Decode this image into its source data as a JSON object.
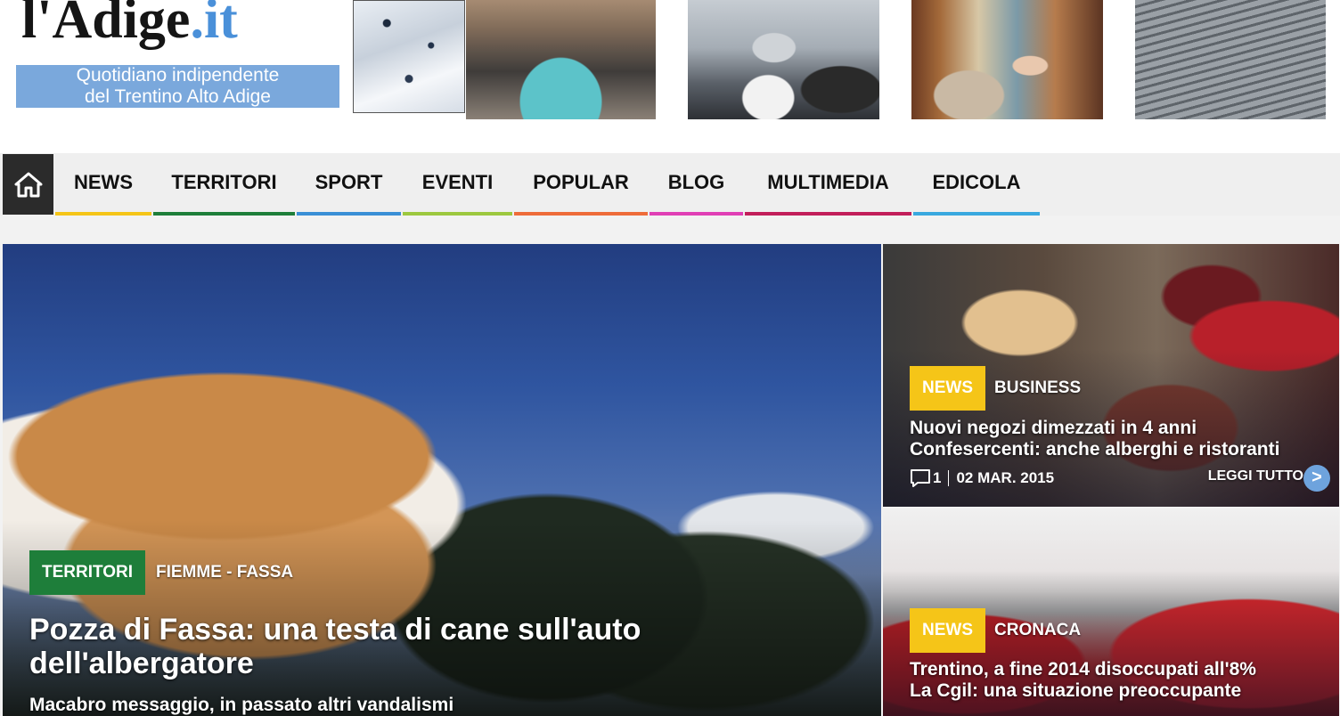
{
  "header": {
    "logo_main": "l'Adige",
    "logo_tld": ".it",
    "tagline_line1": "Quotidiano indipendente",
    "tagline_line2": "del Trentino Alto Adige"
  },
  "nav": {
    "home_icon": "home-icon",
    "items": [
      {
        "label": "NEWS",
        "color": "#f5c518"
      },
      {
        "label": "TERRITORI",
        "color": "#1e7e3a"
      },
      {
        "label": "SPORT",
        "color": "#3a8fd6"
      },
      {
        "label": "EVENTI",
        "color": "#9cc83f"
      },
      {
        "label": "POPULAR",
        "color": "#ee6c3a"
      },
      {
        "label": "BLOG",
        "color": "#e03fb5"
      },
      {
        "label": "MULTIMEDIA",
        "color": "#c21f5a"
      },
      {
        "label": "EDICOLA",
        "color": "#39a8df"
      }
    ]
  },
  "hero": {
    "category": "TERRITORI",
    "category_color": "#1e7e3a",
    "subcategory": "FIEMME - FASSA",
    "title": "Pozza di Fassa: una testa di cane sull'auto dell'albergatore",
    "subtitle": "Macabro messaggio, in passato altri vandalismi"
  },
  "cards": [
    {
      "category": "NEWS",
      "category_color": "#f5c518",
      "subcategory": "BUSINESS",
      "title_line1": "Nuovi negozi dimezzati in 4 anni",
      "title_line2": "Confesercenti: anche alberghi e ristoranti",
      "comments": "1",
      "date": "02 MAR. 2015",
      "read_more": "LEGGI TUTTO"
    },
    {
      "category": "NEWS",
      "category_color": "#f5c518",
      "subcategory": "CRONACA",
      "title_line1": "Trentino, a fine 2014 disoccupati all'8%",
      "title_line2": "La Cgil: una situazione preoccupante"
    }
  ]
}
